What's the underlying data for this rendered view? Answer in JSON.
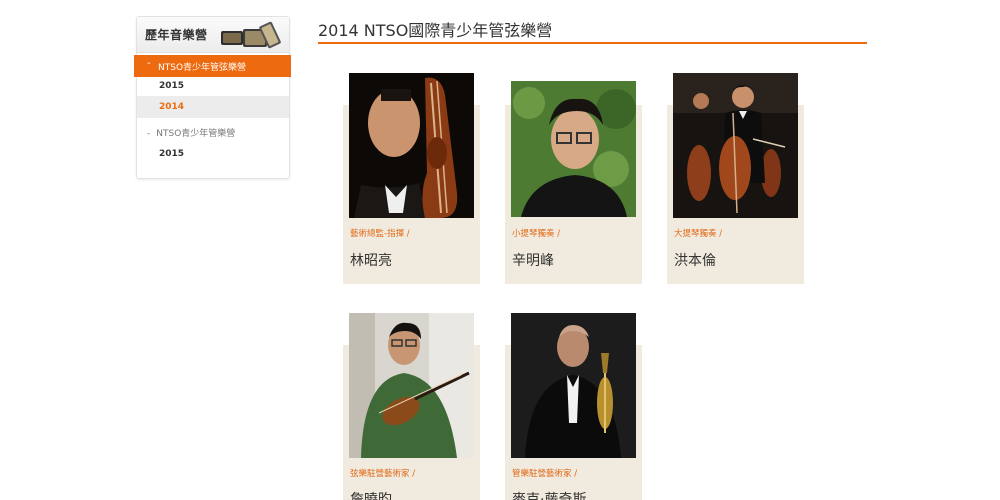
{
  "sidebar": {
    "title": "歷年音樂營",
    "active_section": {
      "dash": "-",
      "label": "NTSO青少年管弦樂營"
    },
    "years": [
      "2015",
      "2014"
    ],
    "active_year": "2014",
    "second_section": {
      "dash": "-",
      "label": "NTSO青少年管樂營"
    },
    "second_years": [
      "2015"
    ]
  },
  "main": {
    "title": "2014 NTSO國際青少年管弦樂營",
    "cards": [
      {
        "role": "藝術總監-指揮 /",
        "name": "林昭亮"
      },
      {
        "role": "小提琴獨奏 /",
        "name": "辛明峰"
      },
      {
        "role": "大提琴獨奏 /",
        "name": "洪本倫"
      },
      {
        "role": "弦樂駐營藝術家 /",
        "name": "詹曉昀"
      },
      {
        "role": "管樂駐營藝術家 /",
        "name": "麥克·藤奇斯"
      }
    ]
  },
  "colors": {
    "accent": "#ee6a0f",
    "card_bg": "#f1ebdf"
  }
}
